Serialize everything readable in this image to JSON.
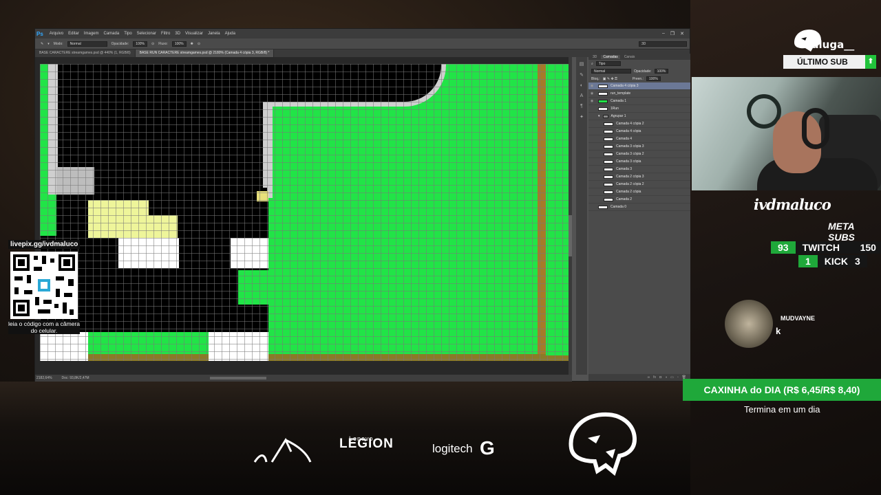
{
  "photoshop": {
    "logo": "Ps",
    "menu": [
      "Arquivo",
      "Editar",
      "Imagem",
      "Camada",
      "Tipo",
      "Selecionar",
      "Filtro",
      "3D",
      "Visualizar",
      "Janela",
      "Ajuda"
    ],
    "options": {
      "mode_label": "Modo:",
      "mode_value": "Normal",
      "opacity_label": "Opacidade:",
      "opacity_value": "100%",
      "flow_label": "Fluxo:",
      "flow_value": "100%",
      "workspace": "3D"
    },
    "tabs": [
      "BASE CARACTERE streamgames.psd @ 440% (1, RGB/8)",
      "BASE RUN CARACTERE streamgames.psd @ 2180% (Camada 4 cópia 3, RGB/8) *"
    ],
    "status": {
      "zoom": "2182,64%",
      "doc": "Doc: 93,8K/2,47M"
    },
    "layers_panel": {
      "tabs": [
        "3D",
        "Camadas",
        "Canais"
      ],
      "filter": "Tipo",
      "blend": "Normal",
      "opacity_label": "Opacidade:",
      "opacity_value": "100%",
      "lock_label": "Bloq.:",
      "fill_label": "Preen.:",
      "fill_value": "100%",
      "layers": [
        {
          "name": "Camada 4 cópia 3",
          "thumb": "white"
        },
        {
          "name": "run_template",
          "thumb": "white"
        },
        {
          "name": "Camada 1",
          "thumb": "green"
        },
        {
          "name": "1Run",
          "thumb": "white"
        },
        {
          "name": "Agrupar 1",
          "thumb": "folder"
        },
        {
          "name": "Camada 4 cópia 2",
          "thumb": "white"
        },
        {
          "name": "Camada 4 cópia",
          "thumb": "white"
        },
        {
          "name": "Camada 4",
          "thumb": "white"
        },
        {
          "name": "Camada 3 cópia 3",
          "thumb": "white"
        },
        {
          "name": "Camada 3 cópia 2",
          "thumb": "white"
        },
        {
          "name": "Camada 3 cópia",
          "thumb": "white"
        },
        {
          "name": "Camada 3",
          "thumb": "white"
        },
        {
          "name": "Camada 2 cópia 3",
          "thumb": "white"
        },
        {
          "name": "Camada 2 cópia 2",
          "thumb": "white"
        },
        {
          "name": "Camada 2 cópia",
          "thumb": "white"
        },
        {
          "name": "Camada 2",
          "thumb": "white"
        },
        {
          "name": "Camada 0",
          "thumb": "white"
        }
      ]
    },
    "colors": {
      "canvas_green": "#21e447",
      "canvas_black": "#000000",
      "pale_yellow": "#eef59a",
      "brown_stripe": "#a57a2a",
      "selection_highlight": "#6b7896"
    }
  },
  "overlay": {
    "qr": {
      "url": "livepix.gg/ivdmaluco",
      "hint": "leia o código com a câmera do celular."
    },
    "top_user": "raluga__",
    "last_sub_label": "ÚLTIMO SUB",
    "streamer_name": "ivdmaluco",
    "meta_label": "META SUBS",
    "meta": [
      {
        "current": "93",
        "platform": "TWITCH",
        "goal": "150"
      },
      {
        "current": "1",
        "platform": "KICK",
        "goal": "3"
      }
    ],
    "chat": {
      "user": "MUDVAYNE",
      "message": "k"
    },
    "goal_bar": {
      "title": "CAXINHA do DIA (R$ 6,45/R$ 8,40)",
      "sub": "Termina em um dia"
    },
    "sponsors": {
      "legion_small": "Lenovo",
      "legion": "LEGION",
      "logitech": "logitech",
      "logitech_g": "G"
    },
    "accent_green": "#1fa83a"
  }
}
